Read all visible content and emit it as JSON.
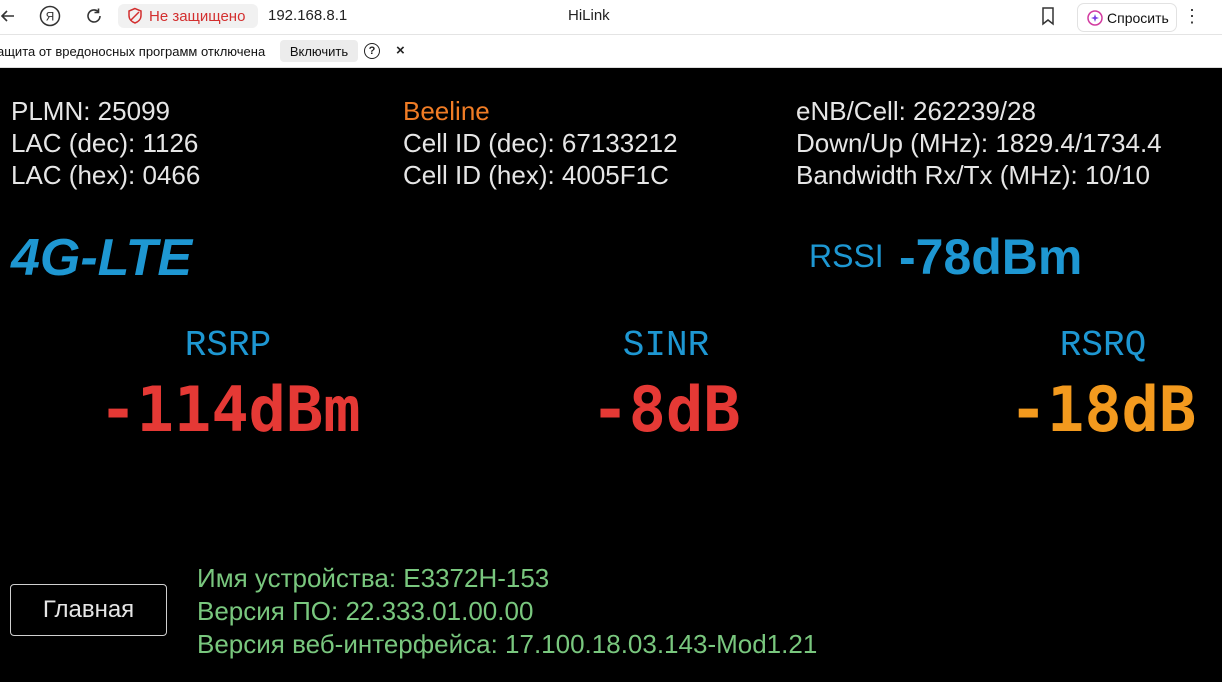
{
  "browser": {
    "security_text": "Не защищено",
    "url": "192.168.8.1",
    "page_title": "HiLink",
    "ask_button": "Спросить",
    "infobar_text": "ащита от вредоносных программ отключена",
    "infobar_button": "Включить",
    "help_glyph": "?",
    "close_glyph": "×"
  },
  "cell_info": {
    "plmn": "PLMN: 25099",
    "lac_dec": "LAC (dec): 1126",
    "lac_hex": "LAC (hex): 0466",
    "operator": "Beeline",
    "cell_id_dec": "Cell ID (dec): 67133212",
    "cell_id_hex": "Cell ID (hex): 4005F1C",
    "enb_cell": "eNB/Cell: 262239/28",
    "down_up": "Down/Up (MHz): 1829.4/1734.4",
    "bandwidth": "Bandwidth Rx/Tx (MHz): 10/10"
  },
  "network": {
    "type": "4G-LTE",
    "rssi_label": "RSSI",
    "rssi_value": "-78dBm"
  },
  "metrics": {
    "rsrp_label": "RSRP",
    "rsrp_value": "-114dBm",
    "sinr_label": "SINR",
    "sinr_value": "-8dB",
    "rsrq_label": "RSRQ",
    "rsrq_value": "-18dB"
  },
  "device": {
    "home_button": "Главная",
    "name": "Имя устройства: E3372H-153",
    "firmware": "Версия ПО: 22.333.01.00.00",
    "webui": "Версия веб-интерфейса: 17.100.18.03.143-Mod1.21"
  },
  "colors": {
    "accent_blue": "#1e97d2",
    "bad_red": "#e53935",
    "warn_orange": "#f39a1e",
    "operator_orange": "#f07c25",
    "info_green": "#79c77e"
  }
}
